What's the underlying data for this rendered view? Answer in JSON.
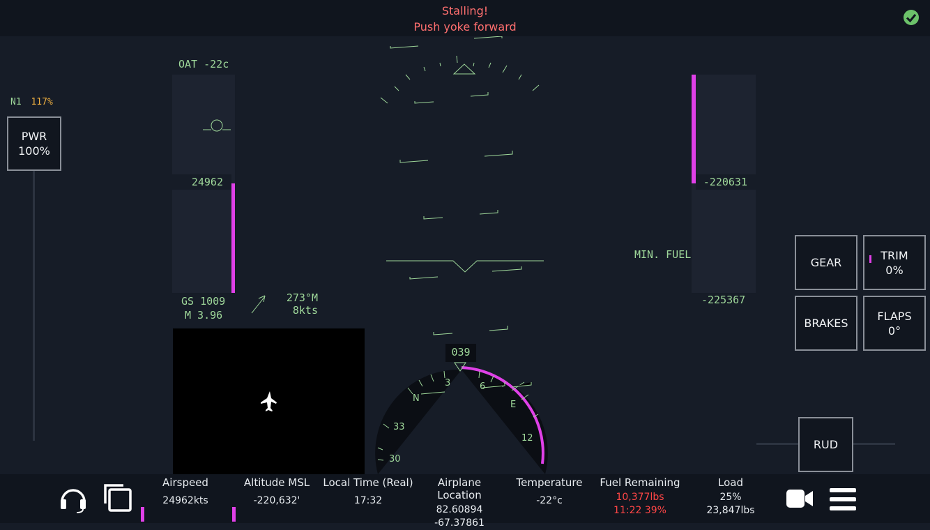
{
  "warning": {
    "line1": "Stalling!",
    "line2": "Push yoke forward"
  },
  "engine": {
    "n1_label": "N1",
    "n1_value": "117%",
    "pwr_label": "PWR",
    "pwr_value": "100%",
    "pwr_fraction": 1.0
  },
  "airspeed_tape": {
    "oat": "OAT -22c",
    "readout": "24962",
    "gs": "GS 1009",
    "mach": "M 3.96"
  },
  "wind": {
    "direction": "273°M",
    "speed": "8kts"
  },
  "altitude_tape": {
    "readout": "-220631",
    "min_fuel": "MIN. FUEL",
    "lower": "-225367"
  },
  "heading": {
    "readout": "039",
    "ticks": [
      "3",
      "6",
      "E",
      "12",
      "33",
      "30",
      "N"
    ]
  },
  "controls": {
    "gear": "GEAR",
    "trim_label": "TRIM",
    "trim_value": "0%",
    "brakes": "BRAKES",
    "flaps_label": "FLAPS",
    "flaps_value": "0°",
    "rud": "RUD"
  },
  "stats": {
    "airspeed": {
      "label": "Airspeed",
      "value": "24962kts"
    },
    "altitude": {
      "label": "Altitude MSL",
      "value": "-220,632'"
    },
    "time": {
      "label": "Local Time (Real)",
      "value": "17:32"
    },
    "location": {
      "label": "Airplane Location",
      "lat": "82.60894",
      "lon": "-67.37861"
    },
    "temperature": {
      "label": "Temperature",
      "value": "-22°c"
    },
    "fuel": {
      "label": "Fuel Remaining",
      "weight": "10,377lbs",
      "time": "11:22 39%"
    },
    "load": {
      "label": "Load",
      "percent": "25%",
      "weight": "23,847lbs"
    }
  },
  "colors": {
    "hud": "#9fd89a",
    "accent": "#e040e8",
    "warning": "#ff6f6f",
    "check": "#6cc26a"
  }
}
